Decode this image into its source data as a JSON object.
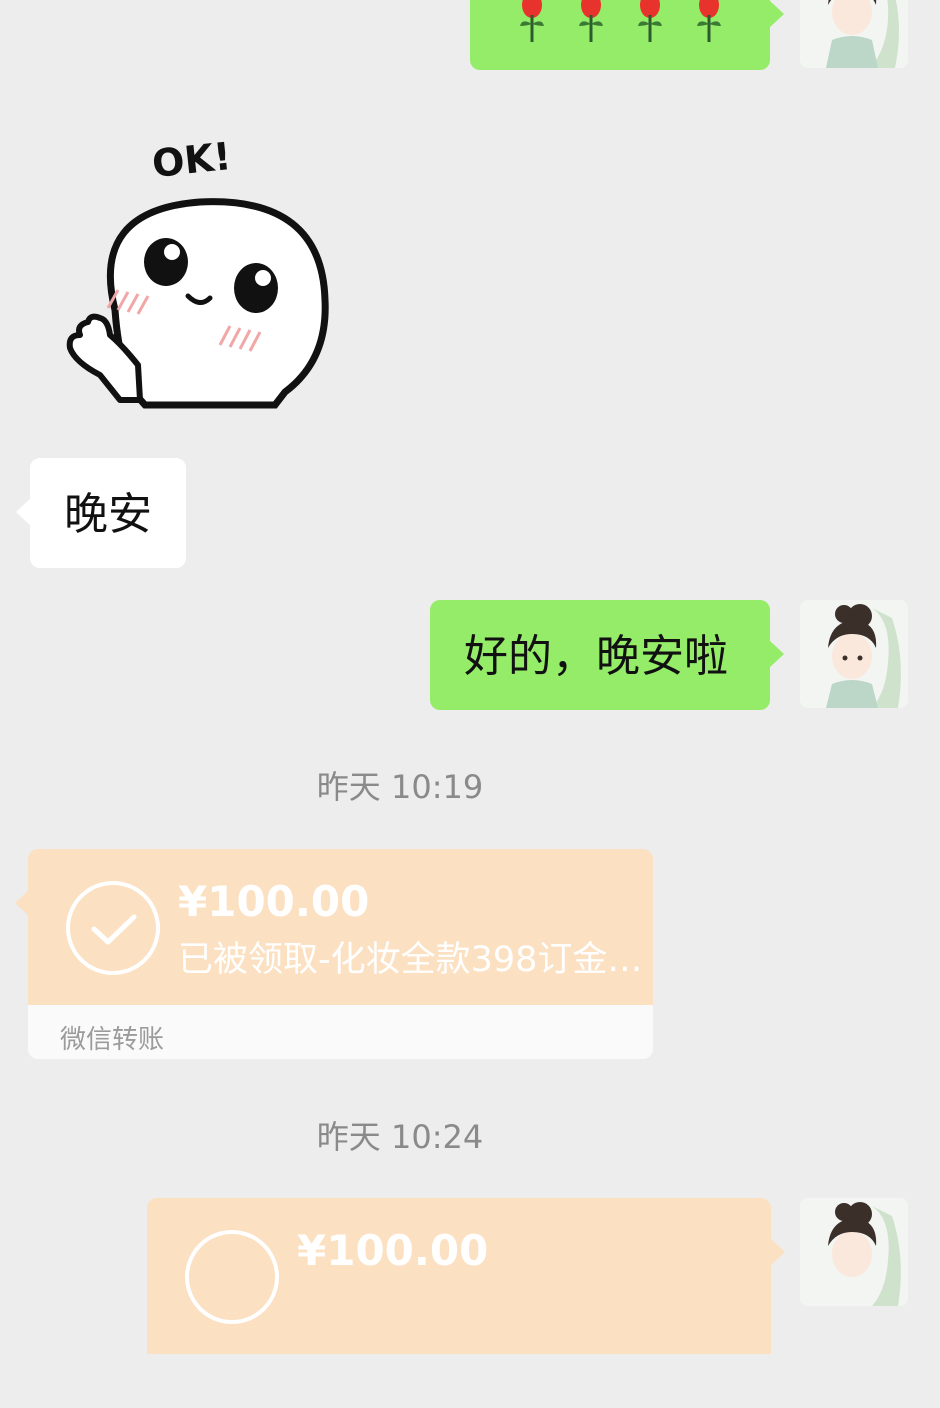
{
  "messages": {
    "sticker_caption": "OK!",
    "received_goodnight": "晚安",
    "sent_reply": "好的，晚安啦",
    "roses_emoji": "rose-emoji-row"
  },
  "timestamps": {
    "first": "昨天 10:19",
    "second": "昨天 10:24"
  },
  "transfer_received": {
    "amount": "¥100.00",
    "description": "已被领取-化妆全款398订金…",
    "footer": "微信转账"
  },
  "transfer_sent": {
    "amount": "¥100.00"
  },
  "colors": {
    "background": "#ededed",
    "sent_bubble": "#95ec69",
    "received_bubble": "#ffffff",
    "transfer_card": "#fce0c2",
    "timestamp_text": "#8a8a8a"
  }
}
